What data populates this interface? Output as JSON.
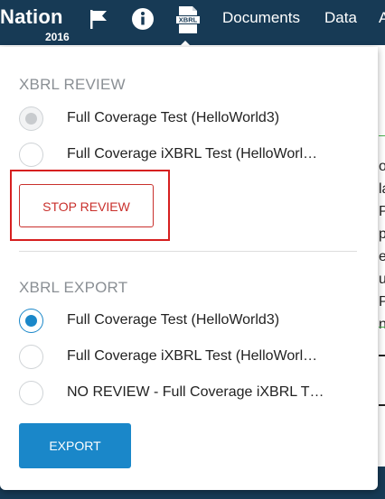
{
  "header": {
    "brand": "Nation",
    "year": "2016",
    "icons": [
      "flag-icon",
      "info-icon",
      "xbrl-icon"
    ],
    "xbrl_icon_text": "XBRL",
    "nav_links": [
      "Documents",
      "Data",
      "A"
    ]
  },
  "background": {
    "side_chars": "o\nla\nP\np\ne\nu\nP\nn"
  },
  "popover": {
    "review": {
      "title": "XBRL REVIEW",
      "options": [
        {
          "label": "Full Coverage Test (HelloWorld3)",
          "state": "disabled-selected"
        },
        {
          "label": "Full Coverage iXBRL Test (HelloWorl…",
          "state": "unselected"
        }
      ],
      "stop_label": "STOP REVIEW"
    },
    "export": {
      "title": "XBRL EXPORT",
      "options": [
        {
          "label": "Full Coverage Test (HelloWorld3)",
          "state": "selected"
        },
        {
          "label": "Full Coverage iXBRL Test (HelloWorl…",
          "state": "unselected"
        },
        {
          "label": "NO REVIEW - Full Coverage iXBRL T…",
          "state": "unselected"
        }
      ],
      "export_label": "EXPORT"
    }
  },
  "colors": {
    "header_bg": "#173a55",
    "accent_blue": "#1a87c9",
    "danger_red": "#c9302c",
    "highlight_red": "#d61f1f",
    "disabled_dot": "#c8cbce"
  }
}
